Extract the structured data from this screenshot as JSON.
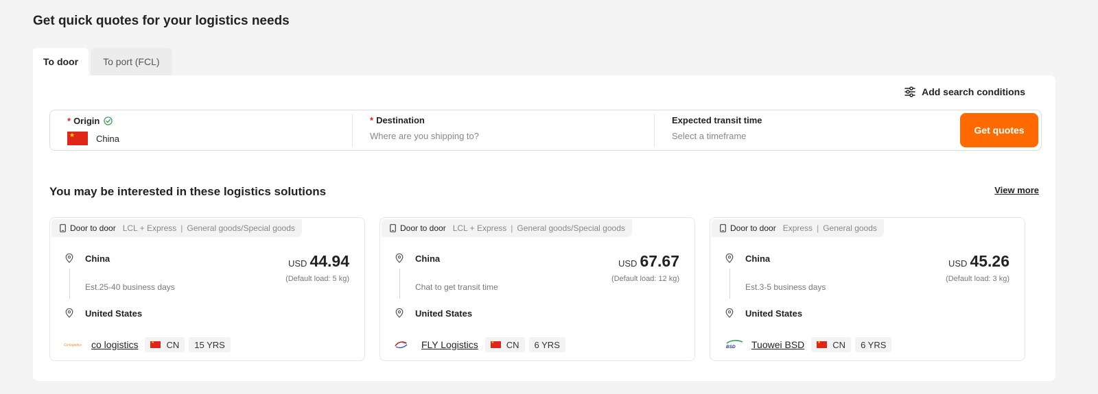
{
  "page": {
    "title": "Get quick quotes for your logistics needs"
  },
  "tabs": [
    {
      "label": "To door",
      "active": true
    },
    {
      "label": "To port (FCL)",
      "active": false
    }
  ],
  "search": {
    "add_conditions_label": "Add search conditions",
    "origin": {
      "label": "Origin",
      "value": "China",
      "icon": "china-flag",
      "verified_icon": "check-circle-icon"
    },
    "destination": {
      "label": "Destination",
      "placeholder": "Where are you shipping to?"
    },
    "transit": {
      "label": "Expected transit time",
      "placeholder": "Select a timeframe"
    },
    "required_mark": "*",
    "submit_label": "Get quotes"
  },
  "solutions": {
    "title": "You may be interested in these logistics solutions",
    "view_more_label": "View more",
    "cards": [
      {
        "mode": "Door to door",
        "tags": [
          "LCL + Express",
          "General goods/Special goods"
        ],
        "origin": "China",
        "destination": "United States",
        "transit": "Est.25-40 business days",
        "currency": "USD",
        "amount": "44.94",
        "load": "(Default load: 5 kg)",
        "supplier": "co logistics",
        "country": "CN",
        "years": "15 YRS"
      },
      {
        "mode": "Door to door",
        "tags": [
          "LCL + Express",
          "General goods/Special goods"
        ],
        "origin": "China",
        "destination": "United States",
        "transit": "Chat to get transit time",
        "currency": "USD",
        "amount": "67.67",
        "load": "(Default load: 12 kg)",
        "supplier": "FLY Logistics",
        "country": "CN",
        "years": "6 YRS"
      },
      {
        "mode": "Door to door",
        "tags": [
          "Express",
          "General goods"
        ],
        "origin": "China",
        "destination": "United States",
        "transit": "Est.3-5 business days",
        "currency": "USD",
        "amount": "45.26",
        "load": "(Default load: 3 kg)",
        "supplier": "Tuowei BSD",
        "country": "CN",
        "years": "6 YRS"
      }
    ]
  },
  "colors": {
    "accent": "#ff6a00",
    "required": "#e02020",
    "verified": "#2e9e44"
  }
}
